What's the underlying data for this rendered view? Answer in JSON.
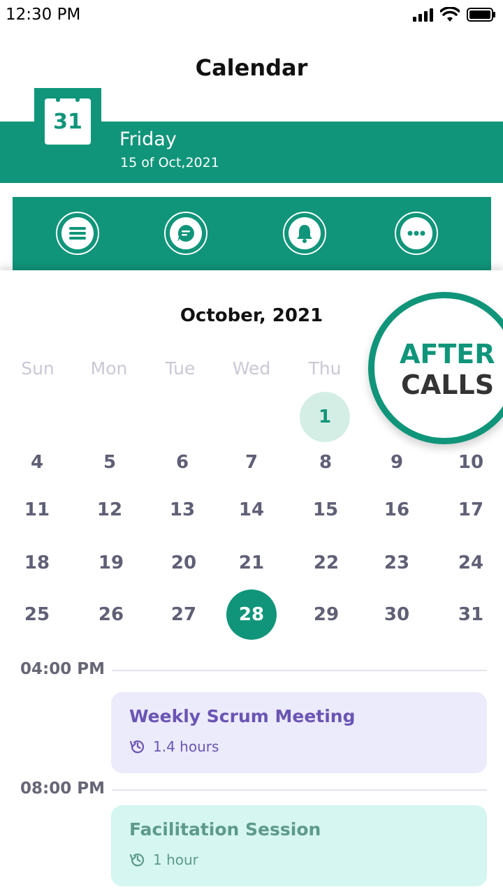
{
  "status": {
    "time": "12:30 PM"
  },
  "header": {
    "title": "Calendar"
  },
  "date_banner": {
    "icon_day": "31",
    "day_name": "Friday",
    "date_text": "15 of Oct,2021"
  },
  "actions": [
    {
      "icon": "menu-icon"
    },
    {
      "icon": "chat-icon"
    },
    {
      "icon": "bell-icon"
    },
    {
      "icon": "more-icon"
    }
  ],
  "calendar": {
    "month": "October, 2021",
    "weekdays": [
      "Sun",
      "Mon",
      "Tue",
      "Wed",
      "Thu"
    ],
    "highlighted_day": "1",
    "selected_day": "28",
    "weeks": [
      [
        "",
        "",
        "",
        "",
        "1",
        "",
        ""
      ],
      [
        "4",
        "5",
        "6",
        "7",
        "8",
        "9",
        "10"
      ],
      [
        "11",
        "12",
        "13",
        "14",
        "15",
        "16",
        "17"
      ],
      [
        "18",
        "19",
        "20",
        "21",
        "22",
        "23",
        "24"
      ],
      [
        "25",
        "26",
        "27",
        "28",
        "29",
        "30",
        "31"
      ]
    ]
  },
  "badge": {
    "top": "AFTER",
    "bottom": "CALLS"
  },
  "schedule": [
    {
      "time": "04:00 PM",
      "title": "Weekly Scrum Meeting",
      "duration": "1.4 hours",
      "bg": "#ecebfb",
      "color": "#6a55b4"
    },
    {
      "time": "08:00 PM",
      "title": "Facilitation Session",
      "duration": "1 hour",
      "bg": "#d5f6f1",
      "color": "#5d9a8c"
    }
  ],
  "colors": {
    "accent": "#10957a"
  }
}
